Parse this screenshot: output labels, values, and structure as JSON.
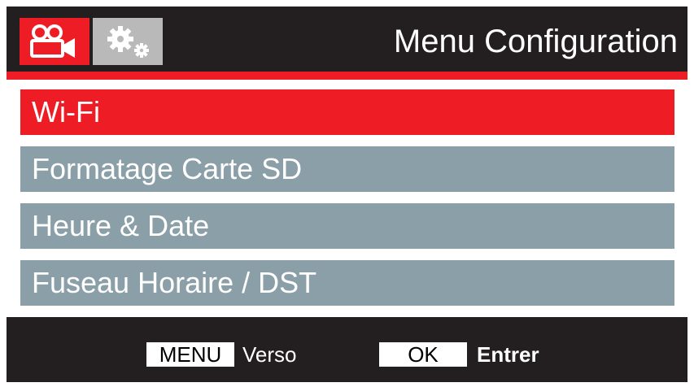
{
  "header": {
    "title": "Menu Configuration",
    "tabs": [
      {
        "icon": "video-camera-icon",
        "active": true
      },
      {
        "icon": "gears-icon",
        "active": false
      }
    ]
  },
  "menu": {
    "items": [
      {
        "label": "Wi-Fi",
        "selected": true
      },
      {
        "label": "Formatage Carte SD",
        "selected": false
      },
      {
        "label": "Heure & Date",
        "selected": false
      },
      {
        "label": "Fuseau Horaire / DST",
        "selected": false
      }
    ]
  },
  "footer": {
    "menu_key": "MENU",
    "menu_action": "Verso",
    "ok_key": "OK",
    "ok_action": "Entrer"
  },
  "colors": {
    "accent": "#ee1c25",
    "item_bg": "#8b9fa8",
    "background": "#231f20",
    "tab_inactive": "#b9b9b9"
  }
}
